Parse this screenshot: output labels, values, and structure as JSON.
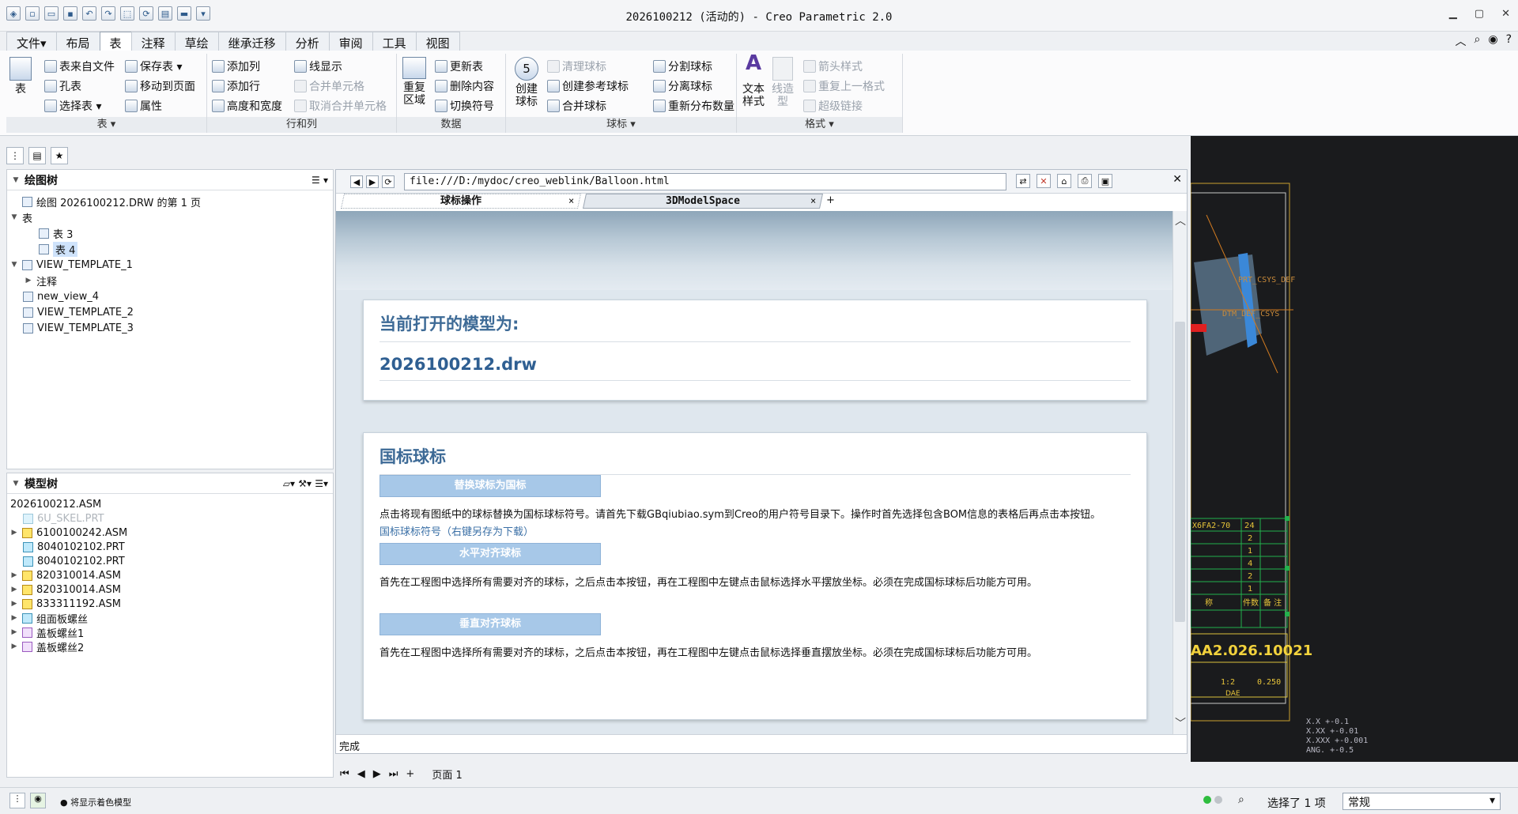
{
  "window": {
    "title": "2026100212 (活动的) - Creo Parametric 2.0"
  },
  "ribbon_tabs": [
    "文件▾",
    "布局",
    "表",
    "注释",
    "草绘",
    "继承迁移",
    "分析",
    "审阅",
    "工具",
    "视图"
  ],
  "ribbon": {
    "table_group": {
      "big": "表",
      "items": [
        "表来自文件",
        "孔表",
        "选择表 ▾",
        "保存表 ▾",
        "移动到页面",
        "属性"
      ],
      "label": "表 ▾"
    },
    "rowcol_group": {
      "items": [
        "添加列",
        "添加行",
        "高度和宽度",
        "线显示",
        "合并单元格",
        "取消合并单元格"
      ],
      "label": "行和列"
    },
    "data_group": {
      "big": "重复区域",
      "items": [
        "更新表",
        "删除内容",
        "切换符号"
      ],
      "label": "数据"
    },
    "balloon_group": {
      "big": "创建球标",
      "items": [
        "清理球标",
        "创建参考球标",
        "合并球标",
        "分割球标",
        "分离球标",
        "重新分布数量"
      ],
      "label": "球标 ▾"
    },
    "format_group": {
      "big1": "文本样式",
      "big2": "线造型",
      "items": [
        "箭头样式",
        "重复上一格式",
        "超级链接"
      ],
      "label": "格式 ▾"
    }
  },
  "drawing_tree": {
    "header": "绘图树",
    "items": [
      "绘图 2026100212.DRW 的第 1 页",
      "表",
      "表 3",
      "表 4",
      "VIEW_TEMPLATE_1",
      "注释",
      "new_view_4",
      "VIEW_TEMPLATE_2",
      "VIEW_TEMPLATE_3"
    ]
  },
  "model_tree": {
    "header": "模型树",
    "items": [
      "2026100212.ASM",
      "6U_SKEL.PRT",
      "6100100242.ASM",
      "8040102102.PRT",
      "8040102102.PRT",
      "820310014.ASM",
      "820310014.ASM",
      "833311192.ASM",
      "组面板螺丝",
      "盖板螺丝1",
      "盖板螺丝2"
    ]
  },
  "browser": {
    "url": "file:///D:/mydoc/creo_weblink/Balloon.html",
    "tabs": [
      "球标操作",
      "3DModelSpace"
    ],
    "status": "完成",
    "card1": {
      "heading": "当前打开的模型为:",
      "model": "2026100212.drw"
    },
    "card2": {
      "heading": "国标球标",
      "btn1": "替换球标为国标",
      "text1": "点击将现有图纸中的球标替换为国标球标符号。请首先下载GBqiubiao.sym到Creo的用户符号目录下。操作时首先选择包含BOM信息的表格后再点击本按钮。",
      "link": "国标球标符号（右键另存为下载）",
      "btn2": "水平对齐球标",
      "text2": "首先在工程图中选择所有需要对齐的球标，之后点击本按钮，再在工程图中左键点击鼠标选择水平摆放坐标。必须在完成国标球标后功能方可用。",
      "btn3": "垂直对齐球标",
      "text3": "首先在工程图中选择所有需要对齐的球标，之后点击本按钮，再在工程图中左键点击鼠标选择垂直摆放坐标。必须在完成国标球标后功能方可用。"
    }
  },
  "pagebar": {
    "label": "页面",
    "number": "1"
  },
  "drawing": {
    "title_no": "AA2.026.10021",
    "part_row": "X6FA2-70",
    "qty": [
      "24",
      "2",
      "1",
      "4",
      "2",
      "1"
    ],
    "headers": [
      "称",
      "件数",
      "备 注"
    ],
    "scale": "1:2",
    "weight": "0.250",
    "tol": [
      "X.X   +-0.1",
      "X.XX  +-0.01",
      "X.XXX +-0.001",
      "ANG.  +-0.5"
    ],
    "csys": [
      "DTM_DEF_CSYS",
      "PRT_CSYS_DEF"
    ],
    "small1": "DAE"
  },
  "statusbar": {
    "message": "将显示着色模型",
    "selected": "选择了 1 项",
    "filter": "常规"
  }
}
